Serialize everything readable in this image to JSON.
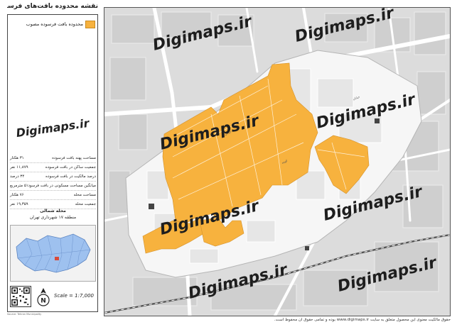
{
  "map": {
    "title": "نقشه محدوده بافت‌های فرسوده مصوب",
    "legend_label": "محدوده بافت فرسوده مصوب",
    "colors": {
      "worn_fabric": "#f7b23e",
      "background": "#dcdcdc",
      "district": "#f6f6f6",
      "roads": "#ffffff",
      "railway": "#555555",
      "inset_city": "#9ec1ef",
      "inset_district": "#d84a3a"
    },
    "watermark": "Digimaps.ir",
    "watermark_side": "Digimaps.ir",
    "stats": [
      {
        "label": "مساحت پهنه بافت فرسوده",
        "value": "۳۱ هکتار"
      },
      {
        "label": "جمعیت ساکن در بافت فرسوده",
        "value": "۱۱,۸۷۹ نفر"
      },
      {
        "label": "درصد مالکیت در بافت فرسوده",
        "value": "۳۴ درصد"
      },
      {
        "label": "میانگین مساحت مسکونی در بافت فرسوده",
        "value": "۵۱ مترمربع"
      },
      {
        "label": "مساحت محله",
        "value": "۷۶ هکتار"
      },
      {
        "label": "جمعیت محله",
        "value": "۱۹,۳۵۹ نفر"
      }
    ],
    "district_name": "محله شمالی",
    "district_region": "منطقه ۱۷ شهرداری تهران",
    "scale": "Scale = 1:7,000",
    "north_label": "N",
    "footer": "حقوق مالکیت معنوی این محصول متعلق به سایت www.digimaps.ir بوده و تمامی حقوق آن محفوظ است.",
    "credit": "Source: Tehran Municipality"
  }
}
